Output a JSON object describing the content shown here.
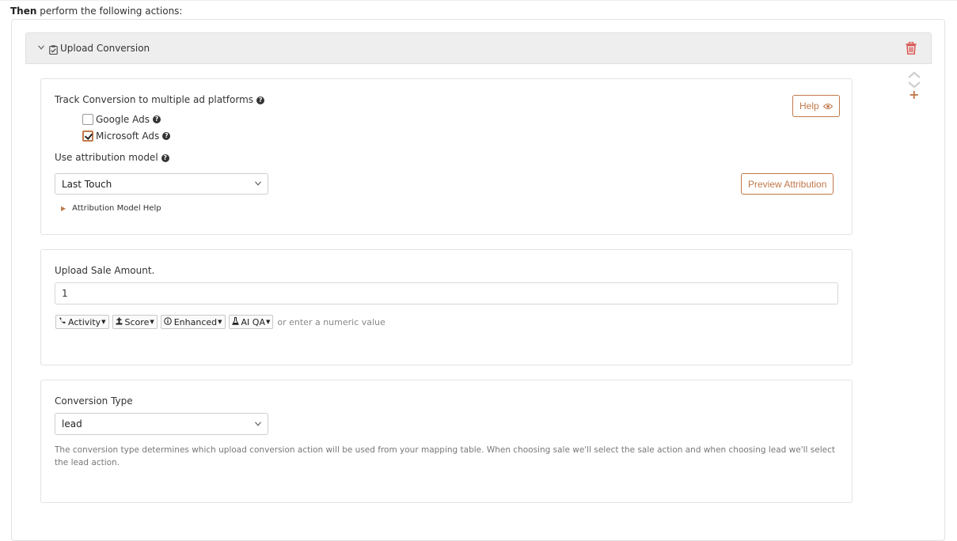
{
  "header": {
    "then_bold": "Then",
    "then_rest": " perform the following actions:"
  },
  "action": {
    "title": "Upload Conversion",
    "icons": {
      "collapse": "chevron-down-icon",
      "clipboard": "clipboard-check-icon",
      "delete": "trash-icon",
      "reorder": "up-down-arrows-icon",
      "add": "plus-icon"
    }
  },
  "tracking": {
    "label": "Track Conversion to multiple ad platforms",
    "help_button": "Help",
    "platforms": [
      {
        "label": "Google Ads",
        "checked": false
      },
      {
        "label": "Microsoft Ads",
        "checked": true
      }
    ],
    "attribution_label": "Use attribution model",
    "attribution_value": "Last Touch",
    "preview_button": "Preview Attribution",
    "attribution_help": "Attribution Model Help"
  },
  "sale_amount": {
    "label": "Upload Sale Amount.",
    "value": "1",
    "tokens": [
      {
        "label": "Activity",
        "icon": "phone-icon"
      },
      {
        "label": "Score",
        "icon": "scale-icon"
      },
      {
        "label": "Enhanced",
        "icon": "info-circle-icon"
      },
      {
        "label": "AI QA",
        "icon": "flask-icon"
      }
    ],
    "hint": "or enter a numeric value"
  },
  "conversion_type": {
    "label": "Conversion Type",
    "value": "lead",
    "description": "The conversion type determines which upload conversion action will be used from your mapping table. When choosing sale we'll select the sale action and when choosing lead we'll select the lead action."
  },
  "colors": {
    "accent": "#c0794a",
    "delete": "#d9534f",
    "header_bg": "#eeeeee"
  }
}
